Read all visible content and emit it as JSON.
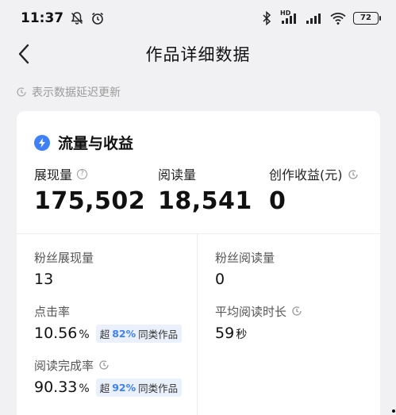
{
  "status_bar": {
    "time": "11:37",
    "battery": "72"
  },
  "nav": {
    "title": "作品详细数据"
  },
  "delay_note": "表示数据延迟更新",
  "card": {
    "title": "流量与收益",
    "top_metrics": [
      {
        "label": "展现量",
        "value": "175,502"
      },
      {
        "label": "阅读量",
        "value": "18,541"
      },
      {
        "label": "创作收益(元)",
        "value": "0"
      }
    ],
    "fan_impressions": {
      "label": "粉丝展现量",
      "value": "13"
    },
    "fan_reads": {
      "label": "粉丝阅读量",
      "value": "0"
    },
    "ctr": {
      "label": "点击率",
      "value": "10.56",
      "unit": "%",
      "badge_prefix": "超",
      "badge_pct": "82%",
      "badge_suffix": "同类作品"
    },
    "avg_read_time": {
      "label": "平均阅读时长",
      "value": "59",
      "unit": "秒"
    },
    "completion": {
      "label": "阅读完成率",
      "value": "90.33",
      "unit": "%",
      "badge_prefix": "超",
      "badge_pct": "92%",
      "badge_suffix": "同类作品"
    }
  },
  "colors": {
    "accent": "#3f80f6",
    "background": "#f1f1f3",
    "badge_bg": "#eaf1fd"
  }
}
